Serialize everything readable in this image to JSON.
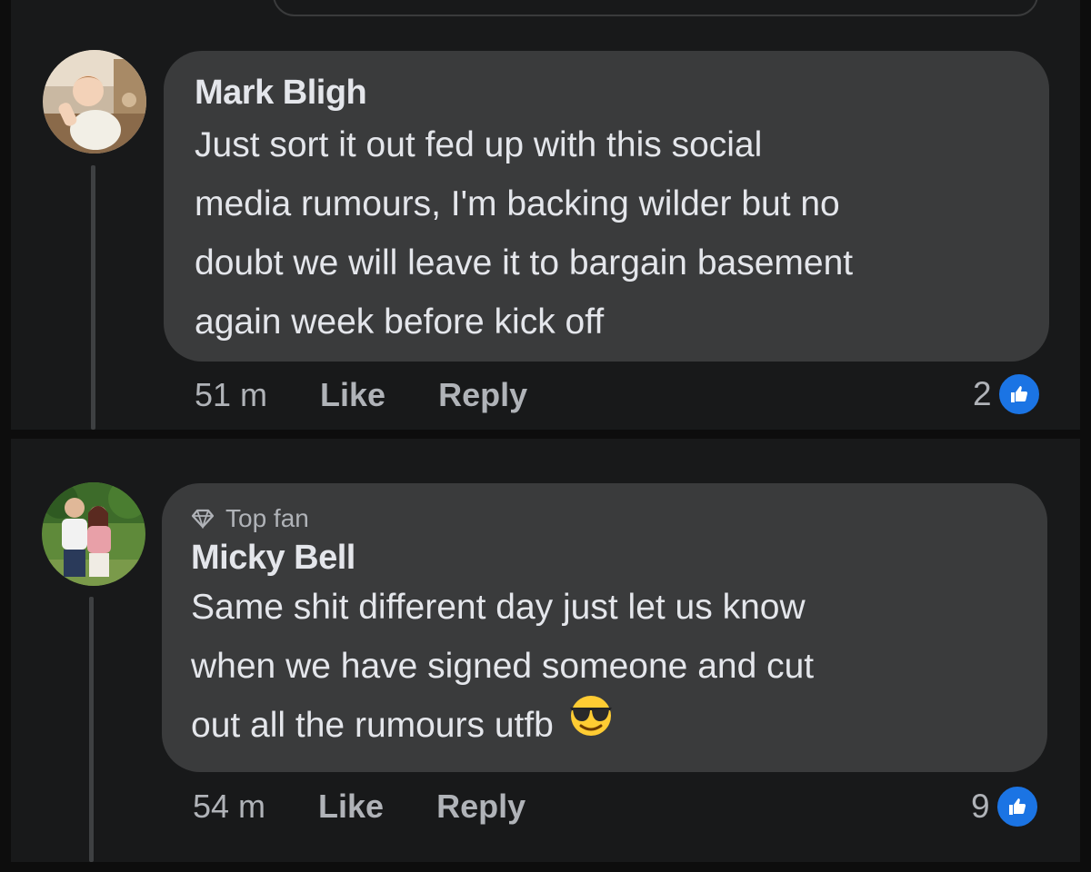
{
  "comments": [
    {
      "badge": "",
      "author": "Mark Bligh",
      "lines": [
        "Just sort it out fed up with this social",
        "media rumours, I'm backing wilder but no",
        "doubt we will leave it to bargain basement",
        "again week before kick off"
      ],
      "emoji": "",
      "time": "51 m",
      "like_label": "Like",
      "reply_label": "Reply",
      "reaction_count": "2",
      "reaction_icon": "like-reaction-icon"
    },
    {
      "badge": "Top fan",
      "badge_icon": "diamond-icon",
      "author": "Micky Bell",
      "lines": [
        "Same shit different day just let us know",
        "when we have signed someone and cut",
        "out all the rumours utfb"
      ],
      "emoji": "sunglasses-face-emoji",
      "time": "54 m",
      "like_label": "Like",
      "reply_label": "Reply",
      "reaction_count": "9",
      "reaction_icon": "like-reaction-icon"
    }
  ],
  "colors": {
    "background": "#18191a",
    "bubble": "#3a3b3c",
    "primary_text": "#e4e6eb",
    "secondary_text": "#b0b3b8",
    "like_blue": "#1b74e4"
  }
}
